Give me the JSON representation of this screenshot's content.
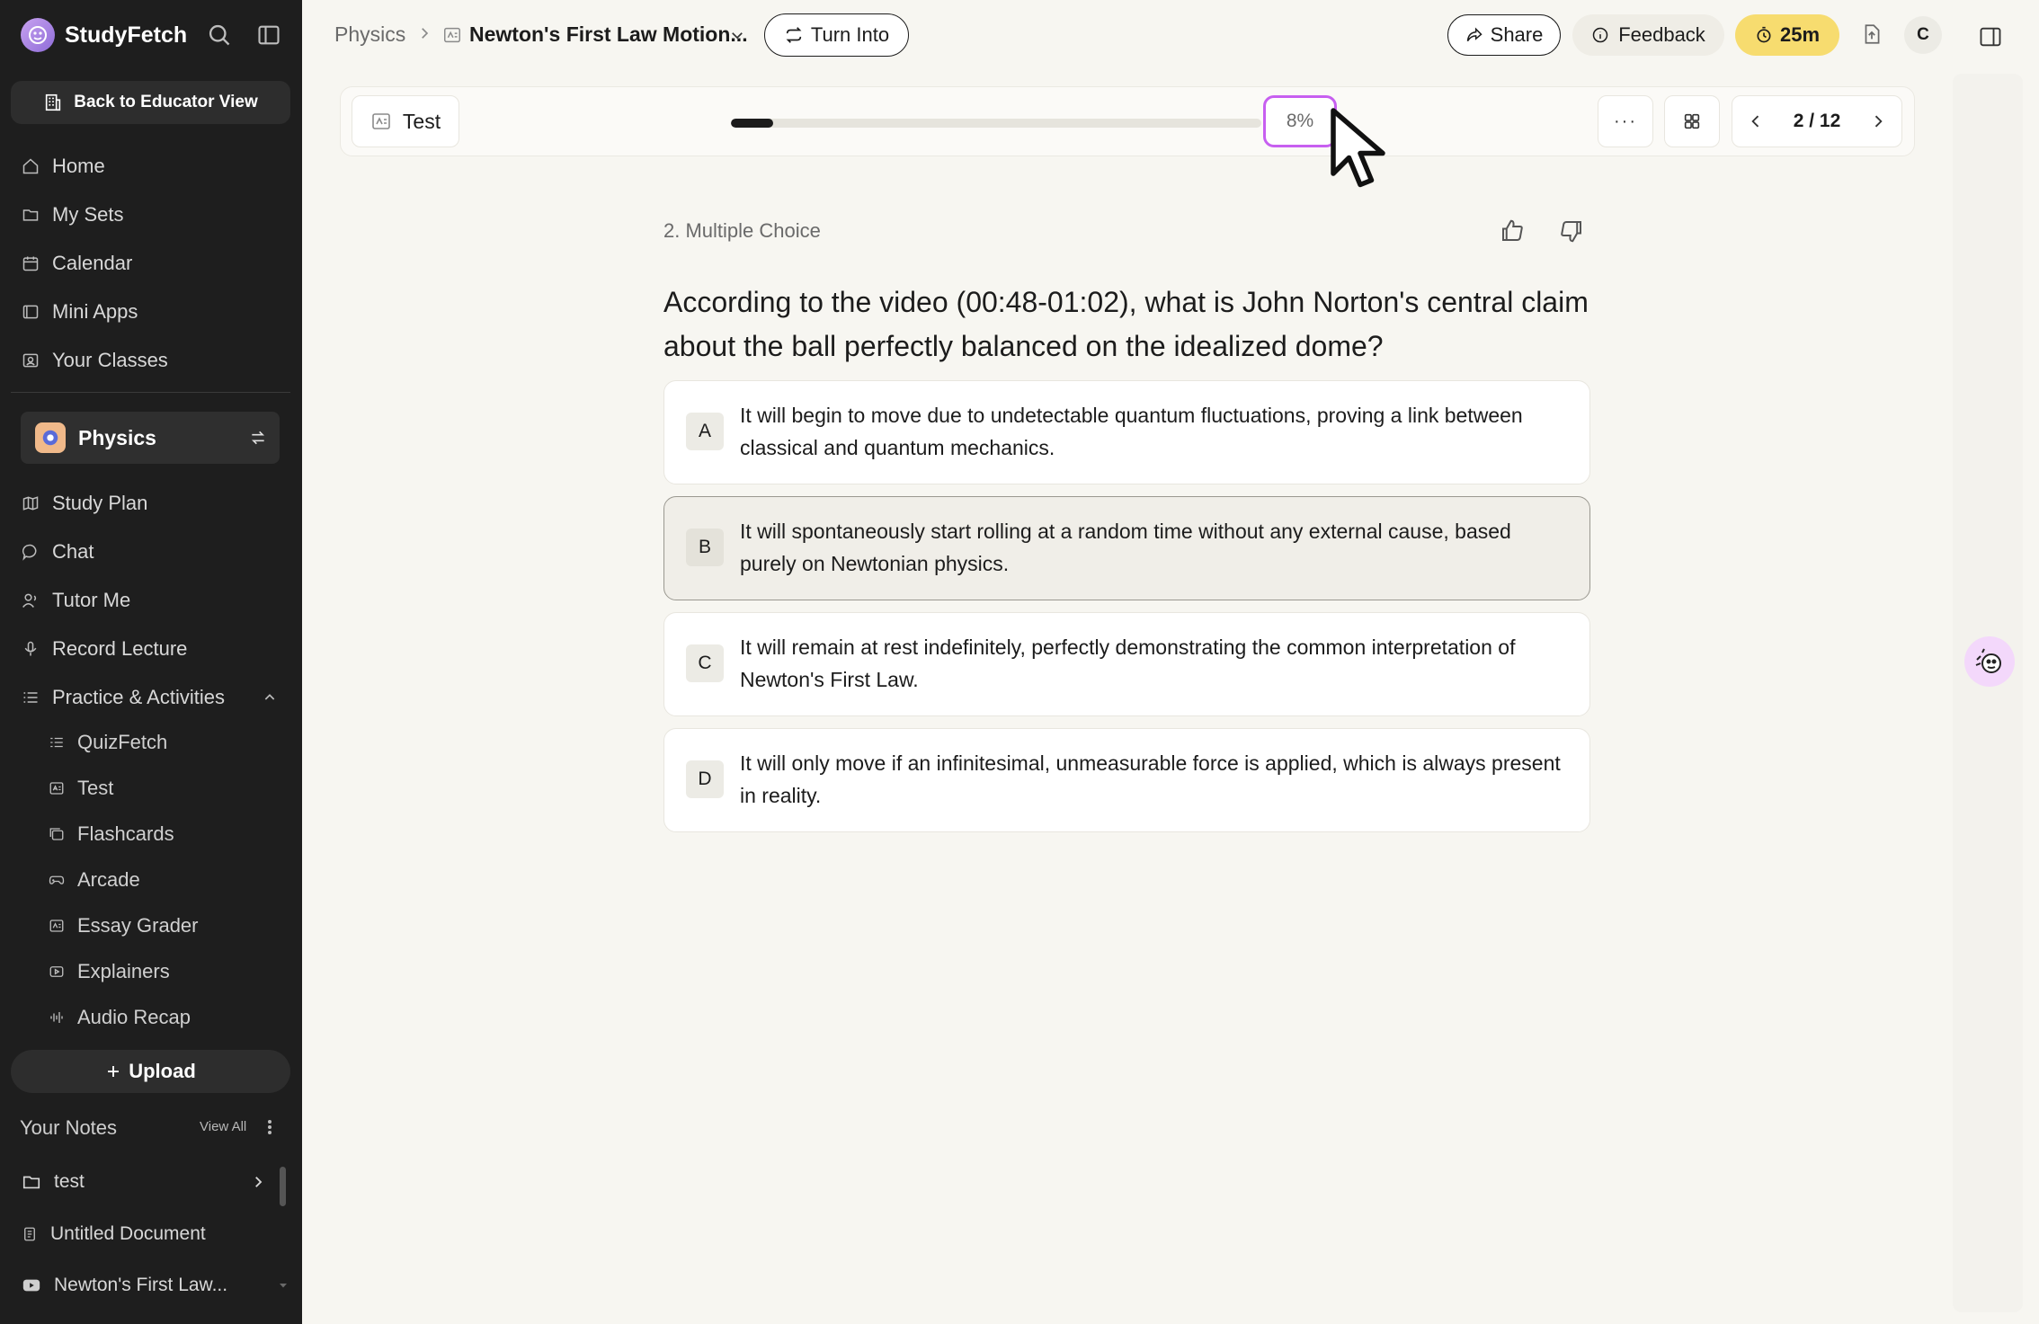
{
  "app": {
    "brand": "StudyFetch",
    "educator_button": "Back to Educator View",
    "nav": [
      {
        "label": "Home",
        "icon": "home-icon"
      },
      {
        "label": "My Sets",
        "icon": "folder-icon"
      },
      {
        "label": "Calendar",
        "icon": "calendar-icon"
      },
      {
        "label": "Mini Apps",
        "icon": "app-icon"
      },
      {
        "label": "Your Classes",
        "icon": "classes-icon"
      }
    ],
    "class_name": "Physics",
    "class_nav": [
      {
        "label": "Study Plan",
        "icon": "map-icon"
      },
      {
        "label": "Chat",
        "icon": "chat-icon"
      },
      {
        "label": "Tutor Me",
        "icon": "tutor-icon"
      },
      {
        "label": "Record Lecture",
        "icon": "mic-icon"
      },
      {
        "label": "Practice & Activities",
        "icon": "list-icon"
      }
    ],
    "activities": [
      {
        "label": "QuizFetch",
        "icon": "quiz-icon"
      },
      {
        "label": "Test",
        "icon": "test-icon"
      },
      {
        "label": "Flashcards",
        "icon": "cards-icon"
      },
      {
        "label": "Arcade",
        "icon": "gamepad-icon"
      },
      {
        "label": "Essay Grader",
        "icon": "essay-icon"
      },
      {
        "label": "Explainers",
        "icon": "video-icon"
      },
      {
        "label": "Audio Recap",
        "icon": "audio-icon"
      }
    ],
    "upload_label": "Upload",
    "notes": {
      "title": "Your Notes",
      "view_all": "View All",
      "items": [
        {
          "label": "test",
          "icon": "folder-icon"
        },
        {
          "label": "Untitled Document",
          "icon": "document-icon"
        },
        {
          "label": "Newton's First Law...",
          "icon": "youtube-icon"
        }
      ]
    }
  },
  "header": {
    "breadcrumb_root": "Physics",
    "breadcrumb_doc": "Newton's First Law Motion...",
    "turn_into": "Turn Into",
    "share": "Share",
    "feedback": "Feedback",
    "timer": "25m",
    "avatar_initial": "C"
  },
  "toolbar": {
    "mode_label": "Test",
    "progress_fraction": 0.08,
    "progress_label": "8%",
    "more_label": "···",
    "pager": "2 / 12"
  },
  "question": {
    "kind": "2. Multiple Choice",
    "text": "According to the video (00:48-01:02), what is John Norton's central claim about the ball perfectly balanced on the idealized dome?",
    "options": [
      {
        "letter": "A",
        "text": "It will begin to move due to undetectable quantum fluctuations, proving a link between classical and quantum mechanics."
      },
      {
        "letter": "B",
        "text": "It will spontaneously start rolling at a random time without any external cause, based purely on Newtonian physics.",
        "selected": true
      },
      {
        "letter": "C",
        "text": "It will remain at rest indefinitely, perfectly demonstrating the common interpretation of Newton's First Law."
      },
      {
        "letter": "D",
        "text": "It will only move if an infinitesimal, unmeasurable force is applied, which is always present in reality."
      }
    ]
  },
  "colors": {
    "sidebar_bg": "#1e1e1e",
    "page_bg": "#f7f6f1",
    "progress_highlight": "#c75ff0",
    "timer_bg": "#f7dc6f"
  }
}
